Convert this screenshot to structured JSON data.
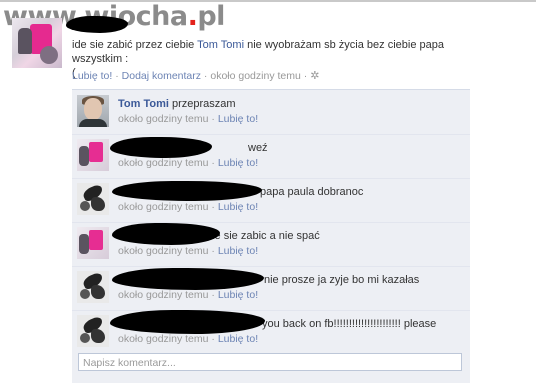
{
  "watermark": {
    "prefix": "www",
    "dot": ".",
    "name": "wiocha",
    "dot2": ".",
    "tld": "pl"
  },
  "post": {
    "text_before": "ide sie zabić przez ciebie",
    "tagged_name": "Tom Tomi",
    "text_after": "nie wyobrażam sb życia bez ciebie papa wszystkim :",
    "text_line2": "(",
    "like": "Lubię to!",
    "sep1": " · ",
    "add_comment": "Dodaj komentarz",
    "sep2": " · ",
    "time": "około godziny temu",
    "sep3": " · ",
    "gear_icon": "gear-icon"
  },
  "comments": [
    {
      "author": "Tom Tomi",
      "text": "przepraszam",
      "time": "około godziny temu",
      "sep": " · ",
      "like": "Lubię to!",
      "avatar": "tom"
    },
    {
      "author": "",
      "text": "weź",
      "time": "około godziny temu",
      "sep": " · ",
      "like": "Lubię to!",
      "avatar": "pink"
    },
    {
      "author": "",
      "text": "papa paula dobranoc",
      "time": "około godziny temu",
      "sep": " · ",
      "like": "Lubię to!",
      "avatar": "bw"
    },
    {
      "author": "",
      "text": "ide sie zabic a nie spać",
      "time": "około godziny temu",
      "sep": " · ",
      "like": "Lubię to!",
      "avatar": "pink"
    },
    {
      "author": "",
      "text": "nie prosze ja zyje bo mi kazałas",
      "time": "około godziny temu",
      "sep": " · ",
      "like": "Lubię to!",
      "avatar": "bw"
    },
    {
      "author": "",
      "text": "you back on fb!!!!!!!!!!!!!!!!!!!!!! please",
      "time": "około godziny temu",
      "sep": " · ",
      "like": "Lubię to!",
      "avatar": "bw"
    }
  ],
  "comment_input": {
    "placeholder": "Napisz komentarz..."
  }
}
